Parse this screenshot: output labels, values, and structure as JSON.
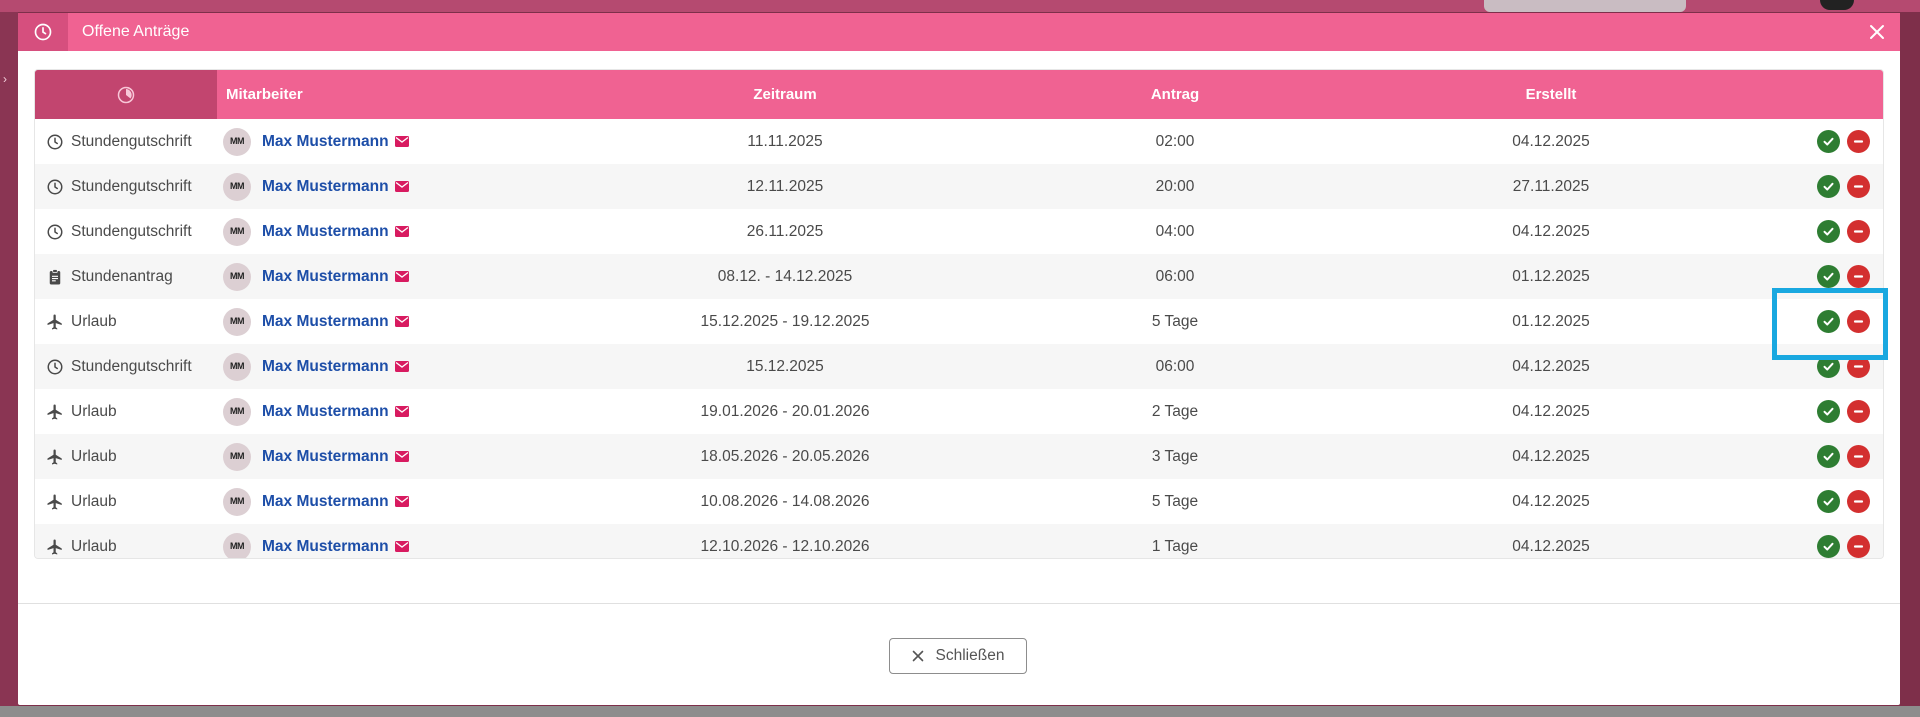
{
  "modal": {
    "title": "Offene Anträge",
    "close_button_label": "Schließen"
  },
  "table": {
    "headers": [
      "Mitarbeiter",
      "Zeitraum",
      "Antrag",
      "Erstellt"
    ],
    "rows": [
      {
        "type": "Stundengutschrift",
        "icon": "clock-icon",
        "initials": "MM",
        "employee": "Max Mustermann",
        "zeitraum": "11.11.2025",
        "antrag": "02:00",
        "erstellt": "04.12.2025"
      },
      {
        "type": "Stundengutschrift",
        "icon": "clock-icon",
        "initials": "MM",
        "employee": "Max Mustermann",
        "zeitraum": "12.11.2025",
        "antrag": "20:00",
        "erstellt": "27.11.2025"
      },
      {
        "type": "Stundengutschrift",
        "icon": "clock-icon",
        "initials": "MM",
        "employee": "Max Mustermann",
        "zeitraum": "26.11.2025",
        "antrag": "04:00",
        "erstellt": "04.12.2025"
      },
      {
        "type": "Stundenantrag",
        "icon": "clipboard-icon",
        "initials": "MM",
        "employee": "Max Mustermann",
        "zeitraum": "08.12. - 14.12.2025",
        "antrag": "06:00",
        "erstellt": "01.12.2025"
      },
      {
        "type": "Urlaub",
        "icon": "airplane-icon",
        "initials": "MM",
        "employee": "Max Mustermann",
        "zeitraum": "15.12.2025 - 19.12.2025",
        "antrag": "5 Tage",
        "erstellt": "01.12.2025"
      },
      {
        "type": "Stundengutschrift",
        "icon": "clock-icon",
        "initials": "MM",
        "employee": "Max Mustermann",
        "zeitraum": "15.12.2025",
        "antrag": "06:00",
        "erstellt": "04.12.2025"
      },
      {
        "type": "Urlaub",
        "icon": "airplane-icon",
        "initials": "MM",
        "employee": "Max Mustermann",
        "zeitraum": "19.01.2026 - 20.01.2026",
        "antrag": "2 Tage",
        "erstellt": "04.12.2025"
      },
      {
        "type": "Urlaub",
        "icon": "airplane-icon",
        "initials": "MM",
        "employee": "Max Mustermann",
        "zeitraum": "18.05.2026 - 20.05.2026",
        "antrag": "3 Tage",
        "erstellt": "04.12.2025"
      },
      {
        "type": "Urlaub",
        "icon": "airplane-icon",
        "initials": "MM",
        "employee": "Max Mustermann",
        "zeitraum": "10.08.2026 - 14.08.2026",
        "antrag": "5 Tage",
        "erstellt": "04.12.2025"
      },
      {
        "type": "Urlaub",
        "icon": "airplane-icon",
        "initials": "MM",
        "employee": "Max Mustermann",
        "zeitraum": "12.10.2026 - 12.10.2026",
        "antrag": "1 Tage",
        "erstellt": "04.12.2025"
      }
    ]
  },
  "colors": {
    "header_pink": "#f06292",
    "header_pink_dark": "#c2456f",
    "approve_green": "#2e7d32",
    "reject_red": "#d32f2f",
    "link_blue": "#1d4ea8",
    "highlight_blue": "#19a8e0"
  }
}
